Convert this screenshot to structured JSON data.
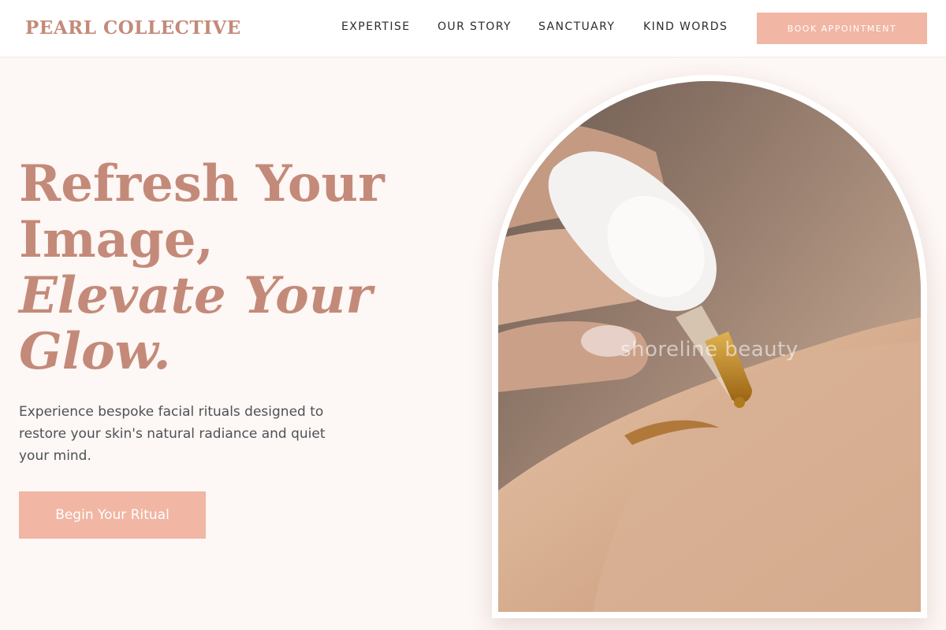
{
  "brand": {
    "name": "PEARL COLLECTIVE"
  },
  "nav": {
    "items": [
      "EXPERTISE",
      "OUR STORY",
      "SANCTUARY",
      "KIND WORDS"
    ],
    "book_label": "BOOK APPOINTMENT"
  },
  "hero": {
    "title_line1": "Refresh Your",
    "title_line2": "Image,",
    "title_line3": "Elevate Your",
    "title_line4": "Glow.",
    "description": "Experience bespoke facial rituals designed to restore your skin's natural radiance and quiet your mind.",
    "cta_label": "Begin Your Ritual"
  },
  "image": {
    "watermark": "shoreline beauty",
    "subject": "hand-with-serum-dropper"
  },
  "colors": {
    "accent": "#c48a79",
    "button": "#f1b6a4",
    "background": "#fdf7f5"
  }
}
